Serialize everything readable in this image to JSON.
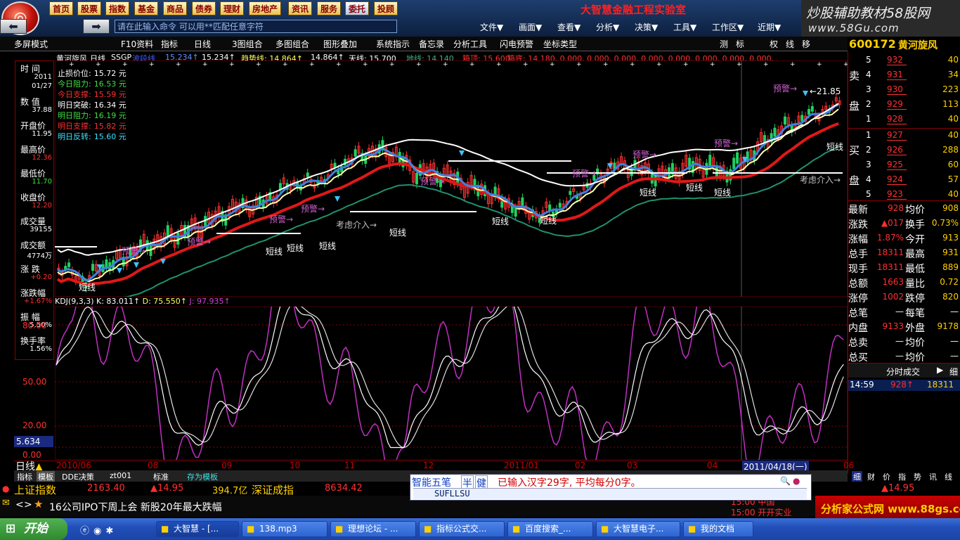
{
  "nav": {
    "buttons": [
      "首页",
      "股票",
      "指数",
      "基金",
      "商品",
      "债券",
      "理财",
      "房地产",
      "资讯",
      "服务",
      "委托",
      "投顾"
    ]
  },
  "command": {
    "placeholder": "请在此输入命令    可以用**匹配任意字符"
  },
  "brand_title": "大智慧金融工程实验室",
  "menus": [
    "文件▼",
    "画面▼",
    "查看▼",
    "分析▼",
    "决策▼",
    "工具▼",
    "工作区▼",
    "近期▼"
  ],
  "watermark": {
    "line1": "炒股辅助教材58股网",
    "line2": "www.58Gu.com"
  },
  "toolbar": {
    "items": [
      "多屏模式",
      "指标",
      "F10资料",
      "日线",
      "3图组合",
      "多图组合",
      "图形叠加",
      "系统指示",
      "备忘录",
      "分析工具",
      "闪电预警",
      "坐标类型"
    ],
    "right_items": [
      "测",
      "标",
      "权",
      "线",
      "移"
    ]
  },
  "stock": {
    "code": "600172",
    "name": "黄河旋风"
  },
  "chart_header": {
    "name": "黄河旋风",
    "period": "日线",
    "items": [
      {
        "text": "SSGP",
        "color": "#ffffff"
      },
      {
        "text": "波段线",
        "color": "#4060ff"
      },
      {
        "text": "15.234↑",
        "color": "#6090ff"
      },
      {
        "text": "15.234↑",
        "color": "#ffffff"
      },
      {
        "text": "趋势线: 14.864↑",
        "color": "#ffff60"
      },
      {
        "text": "14.864↑",
        "color": "#ffffff"
      },
      {
        "text": "天线: 15.700",
        "color": "#ffffff"
      },
      {
        "text": "地线: 14.140",
        "color": "#40b080"
      },
      {
        "text": "箱顶: 15.600",
        "color": "#ff3030"
      },
      {
        "text": "箱底: 14.180, 0.000, 0.000, 0.000, 0.000, 0.000, 0.000, 0.000, 0.000,",
        "color": "#ff3030"
      }
    ]
  },
  "stop_info": [
    {
      "label": "止损价位:",
      "value": "15.72 元",
      "color": "#ffffff"
    },
    {
      "label": "今日阻力:",
      "value": "16.53 元",
      "color": "#40e040"
    },
    {
      "label": "今日支撑:",
      "value": "15.59 元",
      "color": "#ff3030"
    },
    {
      "label": "明日突破:",
      "value": "16.34 元",
      "color": "#ffffff"
    },
    {
      "label": "明日阻力:",
      "value": "16.19 元",
      "color": "#40e040"
    },
    {
      "label": "明日支撑:",
      "value": "15.82 元",
      "color": "#ff3030"
    },
    {
      "label": "明日反转:",
      "value": "15.60 元",
      "color": "#40e0ff"
    }
  ],
  "left_panel": [
    {
      "label": "时  间",
      "values": [
        "2011",
        "01/27"
      ],
      "color": "#ffffff"
    },
    {
      "label": "数  值",
      "values": [
        "37.88"
      ],
      "color": "#ffffff"
    },
    {
      "label": "开盘价",
      "values": [
        "11.95"
      ],
      "color": "#ffffff"
    },
    {
      "label": "最高价",
      "values": [
        "12.36"
      ],
      "color": "#ff3030"
    },
    {
      "label": "最低价",
      "values": [
        "11.70"
      ],
      "color": "#40e040"
    },
    {
      "label": "收盘价",
      "values": [
        "12.20"
      ],
      "color": "#ff3030"
    },
    {
      "label": "成交量",
      "values": [
        "39155"
      ],
      "color": "#ffffff"
    },
    {
      "label": "成交额",
      "values": [
        "4774万"
      ],
      "color": "#ffffff"
    },
    {
      "label": "涨  跌",
      "values": [
        "+0.20"
      ],
      "color": "#ff3030"
    },
    {
      "label": "涨跌幅",
      "values": [
        "+1.67%"
      ],
      "color": "#ff3030"
    },
    {
      "label": "振  幅",
      "values": [
        "5.50%"
      ],
      "color": "#ffffff"
    },
    {
      "label": "换手率",
      "values": [
        "1.56%"
      ],
      "color": "#ffffff"
    }
  ],
  "chart_labels": {
    "warn": "预警→",
    "short": "短线",
    "consider": "考虑介入→",
    "peak": "←21.85"
  },
  "kdj": {
    "header": "KDJ(9,3,3)",
    "k": "K: 83.011↑",
    "d": "D: 75.550↑",
    "j": "J: 97.935↑",
    "levels": [
      "80.00",
      "50.00",
      "20.00",
      "0.00"
    ],
    "cursor_value": "5.634"
  },
  "order_book": {
    "sell_label": [
      "卖",
      "盘"
    ],
    "buy_label": [
      "买",
      "盘"
    ],
    "sell": [
      {
        "n": "5",
        "price": "932",
        "vol": "40"
      },
      {
        "n": "4",
        "price": "931",
        "vol": "34"
      },
      {
        "n": "3",
        "price": "930",
        "vol": "223"
      },
      {
        "n": "2",
        "price": "929",
        "vol": "113"
      },
      {
        "n": "1",
        "price": "928",
        "vol": "40"
      }
    ],
    "buy": [
      {
        "n": "1",
        "price": "927",
        "vol": "40"
      },
      {
        "n": "2",
        "price": "926",
        "vol": "288"
      },
      {
        "n": "3",
        "price": "925",
        "vol": "60"
      },
      {
        "n": "4",
        "price": "924",
        "vol": "57"
      },
      {
        "n": "5",
        "price": "923",
        "vol": "40"
      }
    ]
  },
  "stats": [
    {
      "l1": "最新",
      "v1": "928",
      "l2": "均价",
      "v2": "908"
    },
    {
      "l1": "涨跌",
      "v1": "▲017",
      "l2": "换手",
      "v2": "0.73%"
    },
    {
      "l1": "涨幅",
      "v1": "1.87%",
      "l2": "今开",
      "v2": "913"
    },
    {
      "l1": "总手",
      "v1": "18311",
      "l2": "最高",
      "v2": "931"
    },
    {
      "l1": "现手",
      "v1": "18311",
      "l2": "最低",
      "v2": "889"
    },
    {
      "l1": "总额",
      "v1": "1663",
      "l2": "量比",
      "v2": "0.72"
    },
    {
      "l1": "涨停",
      "v1": "1002",
      "l2": "跌停",
      "v2": "820"
    },
    {
      "l1": "总笔",
      "v1": "—",
      "l2": "每笔",
      "v2": "—"
    },
    {
      "l1": "内盘",
      "v1": "9133",
      "l2": "外盘",
      "v2": "9178"
    },
    {
      "l1": "总卖",
      "v1": "—",
      "l2": "均价",
      "v2": "—"
    },
    {
      "l1": "总买",
      "v1": "—",
      "l2": "均价",
      "v2": "—"
    }
  ],
  "tick": {
    "header": "分时成交",
    "time": "14:59",
    "price": "928↑",
    "vol": "18311"
  },
  "dates": [
    "2010/06",
    "08",
    "09",
    "10",
    "11",
    "12",
    "2011/01",
    "02",
    "03",
    "04",
    "2011/04/18(一)",
    "06"
  ],
  "period_label": "日线",
  "bottom_tabs": [
    "指标",
    "模板",
    "DDE决策",
    "zt001",
    "标准",
    "存为模板"
  ],
  "right_bottom_tabs": [
    "细",
    "财",
    "价",
    "指",
    "势",
    "讯",
    "线"
  ],
  "index_bar": {
    "shanghai_name": "上证指数",
    "shanghai_val": "2163.40",
    "shanghai_chg": "▲14.95",
    "amount": "394.7亿",
    "shenzhen_name": "深证成指",
    "shenzhen_val": "8634.42",
    "right_chg": "▲14.95"
  },
  "ime": {
    "mode": "智能五笔",
    "half": "半",
    "punct": "健",
    "info": "已输入汉字29字, 平均每分0字。",
    "composition": "SUFLLSU"
  },
  "news": "16公司IPO下周上会 新股20年最大跌幅",
  "clock": {
    "line1": "15:00 中国",
    "line2": "15:00 开开实业"
  },
  "ad": "分析家公式网 www.88gs.com",
  "taskbar": {
    "start": "开始",
    "tasks": [
      "大智慧 - [...",
      "138.mp3",
      "理想论坛 - ...",
      "指标公式交...",
      "百度搜索_...",
      "大智慧电子...",
      "我的文档"
    ]
  }
}
